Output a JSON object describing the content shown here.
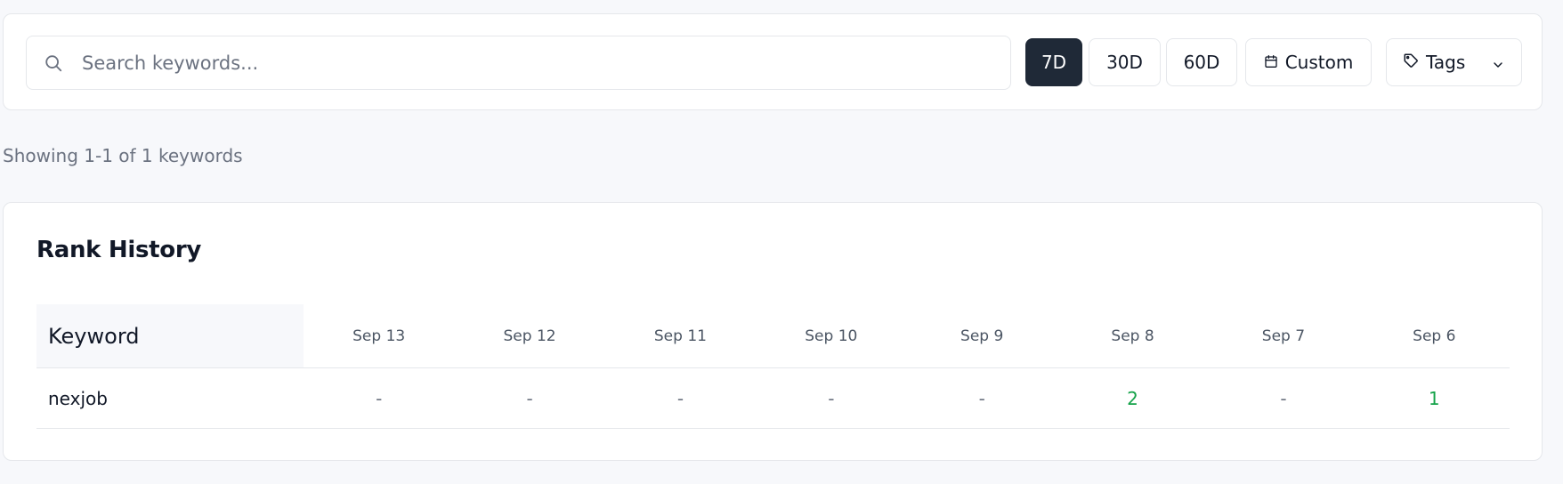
{
  "search": {
    "placeholder": "Search keywords..."
  },
  "filters": {
    "range_7d": "7D",
    "range_30d": "30D",
    "range_60d": "60D",
    "active": "7D",
    "custom_label": "Custom",
    "tags_label": "Tags"
  },
  "summary": {
    "showing_text": "Showing 1-1 of 1 keywords"
  },
  "rank_history": {
    "title": "Rank History",
    "keyword_header": "Keyword",
    "dates": [
      "Sep 13",
      "Sep 12",
      "Sep 11",
      "Sep 10",
      "Sep 9",
      "Sep 8",
      "Sep 7",
      "Sep 6"
    ],
    "rows": [
      {
        "keyword": "nexjob",
        "ranks": [
          "-",
          "-",
          "-",
          "-",
          "-",
          "2",
          "-",
          "1"
        ]
      }
    ]
  },
  "colors": {
    "active_button_bg": "#1f2937",
    "ranked_value": "#16a34a",
    "page_bg": "#f7f8fb"
  },
  "icons": {
    "search": "search-icon",
    "calendar": "calendar-icon",
    "tag": "tag-icon",
    "chevron": "chevron-down-icon"
  }
}
